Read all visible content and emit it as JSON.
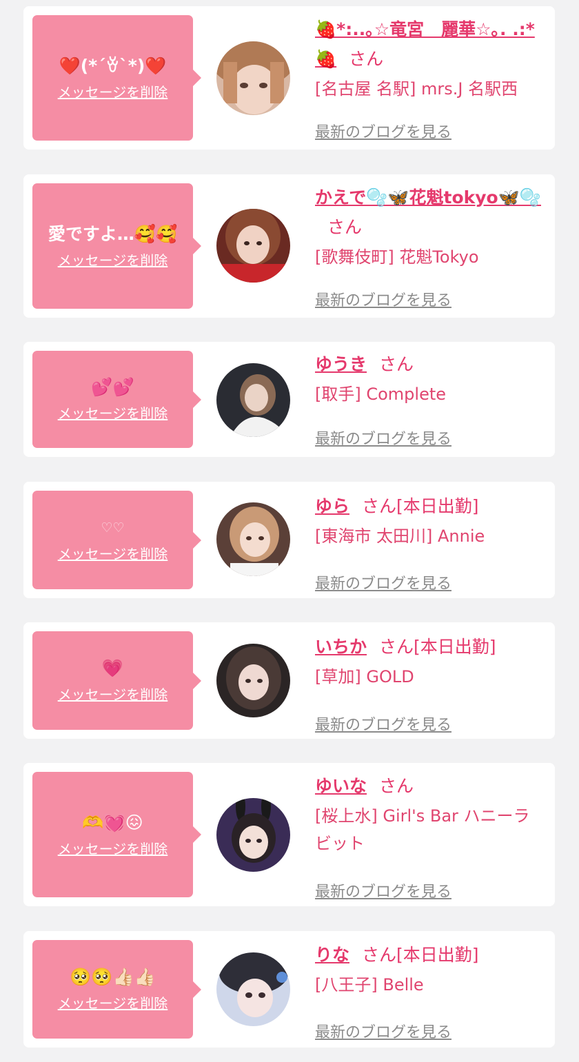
{
  "common": {
    "delete_label": "メッセージを削除",
    "honorific": "さん",
    "blog_label": "最新のブログを見る"
  },
  "cards": [
    {
      "message": "❤️(*´ꈊ`*)❤️",
      "name": "🍓*:..｡☆竜宮　麗華☆｡. .:*🍓",
      "status": "",
      "shop": "[名古屋 名駅] mrs.J 名駅西"
    },
    {
      "message": "愛ですよ…🥰🥰",
      "name": "かえで🫧🦋花魁tokyo🦋🫧",
      "status": "",
      "shop": "[歌舞伎町] 花魁Tokyo"
    },
    {
      "message": "💕💕",
      "name": "ゆうき",
      "status": "",
      "shop": "[取手] Complete"
    },
    {
      "message": "♡♡",
      "name": "ゆら",
      "status": "[本日出勤]",
      "shop": "[東海市 太田川] Annie"
    },
    {
      "message": "💗",
      "name": "いちか",
      "status": "[本日出勤]",
      "shop": "[草加] GOLD"
    },
    {
      "message": "🫶💓😖",
      "name": "ゆいな",
      "status": "",
      "shop": "[桜上水] Girl's Bar ハニーラビット"
    },
    {
      "message": "🥺🥺👍🏻👍🏻",
      "name": "りな",
      "status": "[本日出勤]",
      "shop": "[八王子] Belle"
    }
  ]
}
